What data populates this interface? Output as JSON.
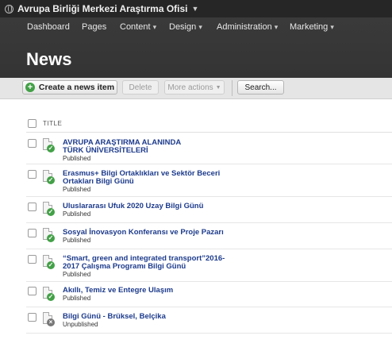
{
  "site": {
    "name": "Avrupa Birliği Merkezi Araştırma Ofisi"
  },
  "nav": [
    {
      "label": "Dashboard",
      "has_caret": false
    },
    {
      "label": "Pages",
      "has_caret": false
    },
    {
      "label": "Content",
      "has_caret": true
    },
    {
      "label": "Design",
      "has_caret": true
    },
    {
      "label": "Administration",
      "has_caret": true
    },
    {
      "label": "Marketing",
      "has_caret": true
    }
  ],
  "page": {
    "title": "News"
  },
  "toolbar": {
    "create_label": "Create a news item",
    "delete_label": "Delete",
    "more_label": "More actions",
    "search_label": "Search..."
  },
  "table": {
    "column_title": "TITLE"
  },
  "items": [
    {
      "title": "AVRUPA ARAŞTIRMA ALANINDA TÜRK ÜNİVERSİTELERİ",
      "status": "Published",
      "published": true
    },
    {
      "title": "Erasmus+ Bilgi Ortaklıkları ve Sektör Beceri Ortakları Bilgi Günü",
      "status": "Published",
      "published": true
    },
    {
      "title": "Uluslararası Ufuk 2020 Uzay Bilgi Günü",
      "status": "Published",
      "published": true
    },
    {
      "title": "Sosyal İnovasyon Konferansı ve Proje Pazarı",
      "status": "Published",
      "published": true
    },
    {
      "title": "“Smart, green and integrated transport”2016-2017 Çalışma Programı Bilgi Günü",
      "status": "Published",
      "published": true
    },
    {
      "title": "Akıllı, Temiz ve Entegre Ulaşım",
      "status": "Published",
      "published": true
    },
    {
      "title": "Bilgi Günü - Brüksel, Belçika",
      "status": "Unpublished",
      "published": false
    }
  ]
}
